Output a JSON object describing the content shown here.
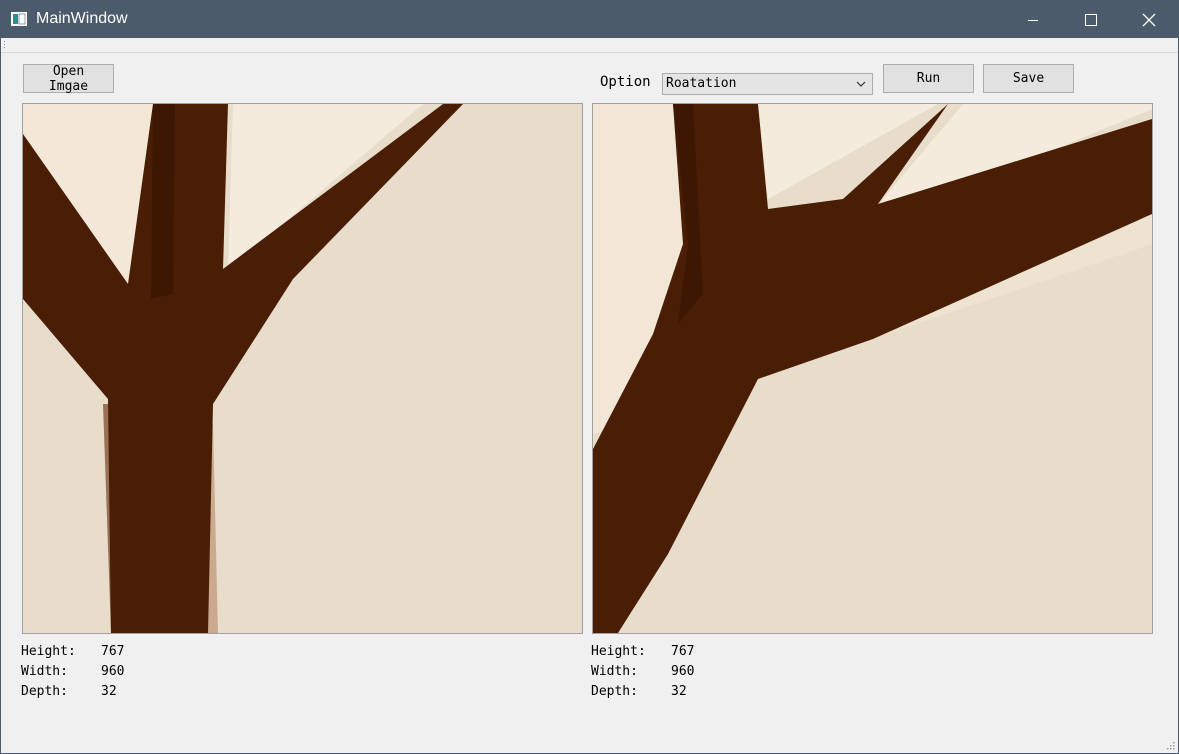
{
  "window": {
    "title": "MainWindow",
    "controls": {
      "minimize": "minimize-icon",
      "maximize": "maximize-icon",
      "close": "close-icon"
    }
  },
  "toolbar": {
    "open_label": "Open Imgae",
    "option_label": "Option",
    "option_selected": "Roatation",
    "run_label": "Run",
    "save_label": "Save"
  },
  "left_image": {
    "height_label": "Height:",
    "height_value": "767",
    "width_label": "Width:",
    "width_value": "960",
    "depth_label": "Depth:",
    "depth_value": "32"
  },
  "right_image": {
    "height_label": "Height:",
    "height_value": "767",
    "width_label": "Width:",
    "width_value": "960",
    "depth_label": "Depth:",
    "depth_value": "32"
  },
  "colors": {
    "titlebar": "#4c5b6b",
    "background": "#f0f0f0",
    "image_branch": "#4a1d05",
    "image_background": "#e8dccb"
  }
}
